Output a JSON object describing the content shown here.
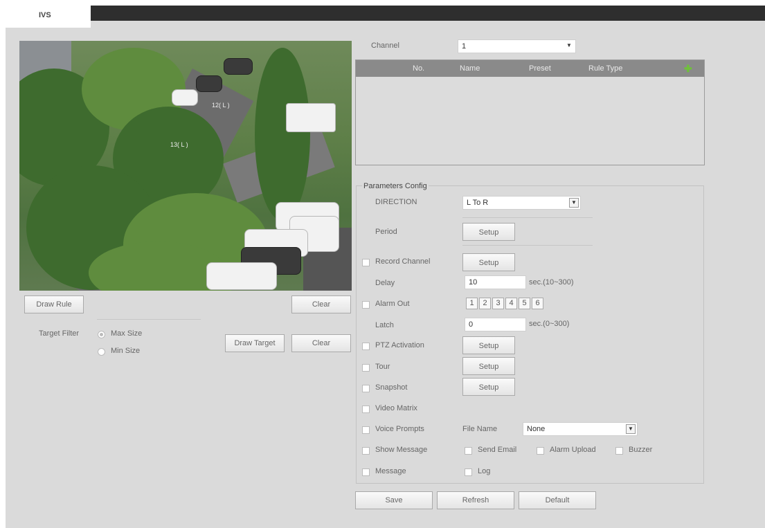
{
  "tab": {
    "label": "IVS"
  },
  "video": {
    "rule_label_1": "12( L )",
    "rule_label_2": "13( L )"
  },
  "left": {
    "draw_rule": "Draw Rule",
    "clear_rule": "Clear",
    "target_filter_label": "Target Filter",
    "max_size": "Max Size",
    "min_size": "Min Size",
    "draw_target": "Draw Target",
    "clear_target": "Clear"
  },
  "channel": {
    "label": "Channel",
    "value": "1"
  },
  "rule_table": {
    "columns": [
      "No.",
      "Name",
      "Preset",
      "Rule Type"
    ],
    "rows": []
  },
  "params": {
    "legend": "Parameters Config",
    "direction_label": "DIRECTION",
    "direction_value": "L To R",
    "period_label": "Period",
    "setup": "Setup",
    "record_channel": "Record Channel",
    "delay_label": "Delay",
    "delay_value": "10",
    "delay_unit": "sec.(10~300)",
    "alarm_out": "Alarm Out",
    "alarm_numbers": [
      "1",
      "2",
      "3",
      "4",
      "5",
      "6"
    ],
    "latch_label": "Latch",
    "latch_value": "0",
    "latch_unit": "sec.(0~300)",
    "ptz_activation": "PTZ Activation",
    "tour": "Tour",
    "snapshot": "Snapshot",
    "video_matrix": "Video Matrix",
    "voice_prompts": "Voice Prompts",
    "file_name_label": "File Name",
    "file_name_value": "None",
    "show_message": "Show Message",
    "send_email": "Send Email",
    "alarm_upload": "Alarm Upload",
    "buzzer": "Buzzer",
    "message": "Message",
    "log": "Log"
  },
  "footer": {
    "save": "Save",
    "refresh": "Refresh",
    "default": "Default"
  },
  "colors": {
    "add_icon": "#6fc13a",
    "table_header": "#8a8a8a",
    "topbar": "#2e2e2e"
  }
}
